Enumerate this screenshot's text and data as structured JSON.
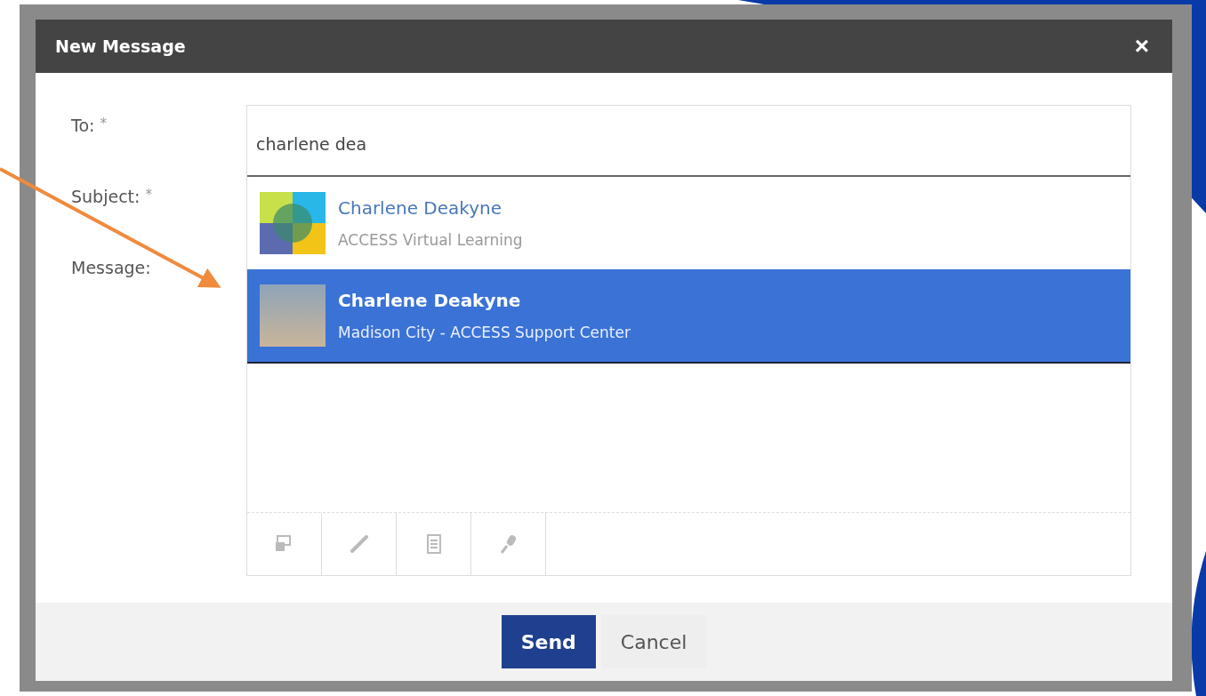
{
  "dialog": {
    "title": "New Message",
    "close": "×"
  },
  "fields": [
    {
      "label": "To:",
      "required_mark": "*"
    },
    {
      "label": "Subject:",
      "required_mark": "*"
    },
    {
      "label": "Message:"
    }
  ],
  "to_value": "charlene dea",
  "suggestions": [
    {
      "name": "Charlene Deakyne",
      "detail": "ACCESS Virtual Learning",
      "selected": false,
      "kind": "logo"
    },
    {
      "name": "Charlene Deakyne",
      "detail": "Madison City - ACCESS Support Center",
      "selected": true,
      "kind": "photo"
    }
  ],
  "buttons": [
    {
      "label": "Send",
      "kind": "primary"
    },
    {
      "label": "Cancel",
      "kind": "secondary"
    }
  ]
}
